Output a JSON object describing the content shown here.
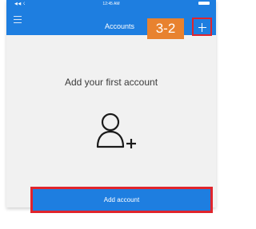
{
  "status_bar": {
    "signal": "◀◀ ☇",
    "time": "12:45 AM"
  },
  "header": {
    "title": "Accounts",
    "menu_icon": "hamburger-menu-icon",
    "add_icon": "plus-icon"
  },
  "annotation": {
    "step_label": "3-2"
  },
  "main": {
    "heading": "Add your first account",
    "illustration_icon": "add-person-icon",
    "add_button_label": "Add account"
  },
  "colors": {
    "accent_blue": "#1e7ee0",
    "highlight_red": "#e0242c",
    "badge_orange": "#e8822f"
  }
}
